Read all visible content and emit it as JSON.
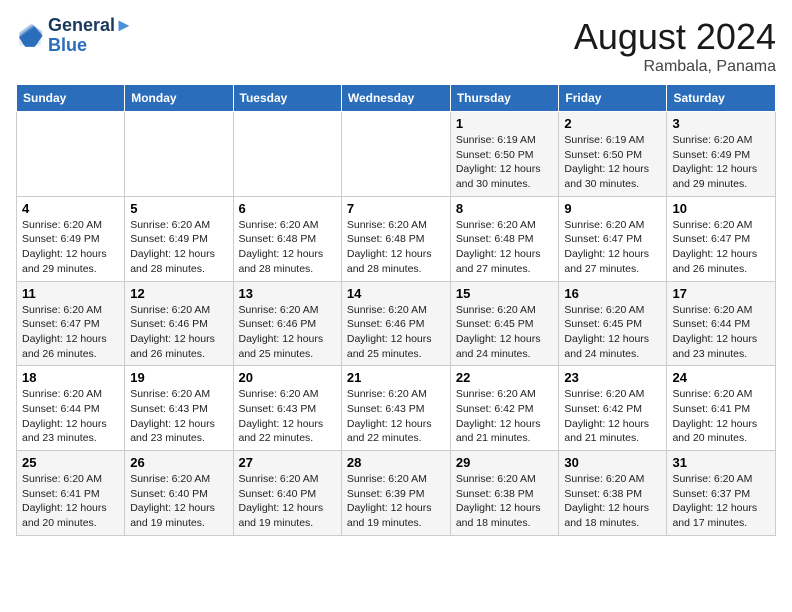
{
  "logo": {
    "line1": "General",
    "line2": "Blue"
  },
  "title": "August 2024",
  "subtitle": "Rambala, Panama",
  "days_of_week": [
    "Sunday",
    "Monday",
    "Tuesday",
    "Wednesday",
    "Thursday",
    "Friday",
    "Saturday"
  ],
  "weeks": [
    [
      {
        "day": "",
        "info": ""
      },
      {
        "day": "",
        "info": ""
      },
      {
        "day": "",
        "info": ""
      },
      {
        "day": "",
        "info": ""
      },
      {
        "day": "1",
        "info": "Sunrise: 6:19 AM\nSunset: 6:50 PM\nDaylight: 12 hours and 30 minutes."
      },
      {
        "day": "2",
        "info": "Sunrise: 6:19 AM\nSunset: 6:50 PM\nDaylight: 12 hours and 30 minutes."
      },
      {
        "day": "3",
        "info": "Sunrise: 6:20 AM\nSunset: 6:49 PM\nDaylight: 12 hours and 29 minutes."
      }
    ],
    [
      {
        "day": "4",
        "info": "Sunrise: 6:20 AM\nSunset: 6:49 PM\nDaylight: 12 hours and 29 minutes."
      },
      {
        "day": "5",
        "info": "Sunrise: 6:20 AM\nSunset: 6:49 PM\nDaylight: 12 hours and 28 minutes."
      },
      {
        "day": "6",
        "info": "Sunrise: 6:20 AM\nSunset: 6:48 PM\nDaylight: 12 hours and 28 minutes."
      },
      {
        "day": "7",
        "info": "Sunrise: 6:20 AM\nSunset: 6:48 PM\nDaylight: 12 hours and 28 minutes."
      },
      {
        "day": "8",
        "info": "Sunrise: 6:20 AM\nSunset: 6:48 PM\nDaylight: 12 hours and 27 minutes."
      },
      {
        "day": "9",
        "info": "Sunrise: 6:20 AM\nSunset: 6:47 PM\nDaylight: 12 hours and 27 minutes."
      },
      {
        "day": "10",
        "info": "Sunrise: 6:20 AM\nSunset: 6:47 PM\nDaylight: 12 hours and 26 minutes."
      }
    ],
    [
      {
        "day": "11",
        "info": "Sunrise: 6:20 AM\nSunset: 6:47 PM\nDaylight: 12 hours and 26 minutes."
      },
      {
        "day": "12",
        "info": "Sunrise: 6:20 AM\nSunset: 6:46 PM\nDaylight: 12 hours and 26 minutes."
      },
      {
        "day": "13",
        "info": "Sunrise: 6:20 AM\nSunset: 6:46 PM\nDaylight: 12 hours and 25 minutes."
      },
      {
        "day": "14",
        "info": "Sunrise: 6:20 AM\nSunset: 6:46 PM\nDaylight: 12 hours and 25 minutes."
      },
      {
        "day": "15",
        "info": "Sunrise: 6:20 AM\nSunset: 6:45 PM\nDaylight: 12 hours and 24 minutes."
      },
      {
        "day": "16",
        "info": "Sunrise: 6:20 AM\nSunset: 6:45 PM\nDaylight: 12 hours and 24 minutes."
      },
      {
        "day": "17",
        "info": "Sunrise: 6:20 AM\nSunset: 6:44 PM\nDaylight: 12 hours and 23 minutes."
      }
    ],
    [
      {
        "day": "18",
        "info": "Sunrise: 6:20 AM\nSunset: 6:44 PM\nDaylight: 12 hours and 23 minutes."
      },
      {
        "day": "19",
        "info": "Sunrise: 6:20 AM\nSunset: 6:43 PM\nDaylight: 12 hours and 23 minutes."
      },
      {
        "day": "20",
        "info": "Sunrise: 6:20 AM\nSunset: 6:43 PM\nDaylight: 12 hours and 22 minutes."
      },
      {
        "day": "21",
        "info": "Sunrise: 6:20 AM\nSunset: 6:43 PM\nDaylight: 12 hours and 22 minutes."
      },
      {
        "day": "22",
        "info": "Sunrise: 6:20 AM\nSunset: 6:42 PM\nDaylight: 12 hours and 21 minutes."
      },
      {
        "day": "23",
        "info": "Sunrise: 6:20 AM\nSunset: 6:42 PM\nDaylight: 12 hours and 21 minutes."
      },
      {
        "day": "24",
        "info": "Sunrise: 6:20 AM\nSunset: 6:41 PM\nDaylight: 12 hours and 20 minutes."
      }
    ],
    [
      {
        "day": "25",
        "info": "Sunrise: 6:20 AM\nSunset: 6:41 PM\nDaylight: 12 hours and 20 minutes."
      },
      {
        "day": "26",
        "info": "Sunrise: 6:20 AM\nSunset: 6:40 PM\nDaylight: 12 hours and 19 minutes."
      },
      {
        "day": "27",
        "info": "Sunrise: 6:20 AM\nSunset: 6:40 PM\nDaylight: 12 hours and 19 minutes."
      },
      {
        "day": "28",
        "info": "Sunrise: 6:20 AM\nSunset: 6:39 PM\nDaylight: 12 hours and 19 minutes."
      },
      {
        "day": "29",
        "info": "Sunrise: 6:20 AM\nSunset: 6:38 PM\nDaylight: 12 hours and 18 minutes."
      },
      {
        "day": "30",
        "info": "Sunrise: 6:20 AM\nSunset: 6:38 PM\nDaylight: 12 hours and 18 minutes."
      },
      {
        "day": "31",
        "info": "Sunrise: 6:20 AM\nSunset: 6:37 PM\nDaylight: 12 hours and 17 minutes."
      }
    ]
  ]
}
